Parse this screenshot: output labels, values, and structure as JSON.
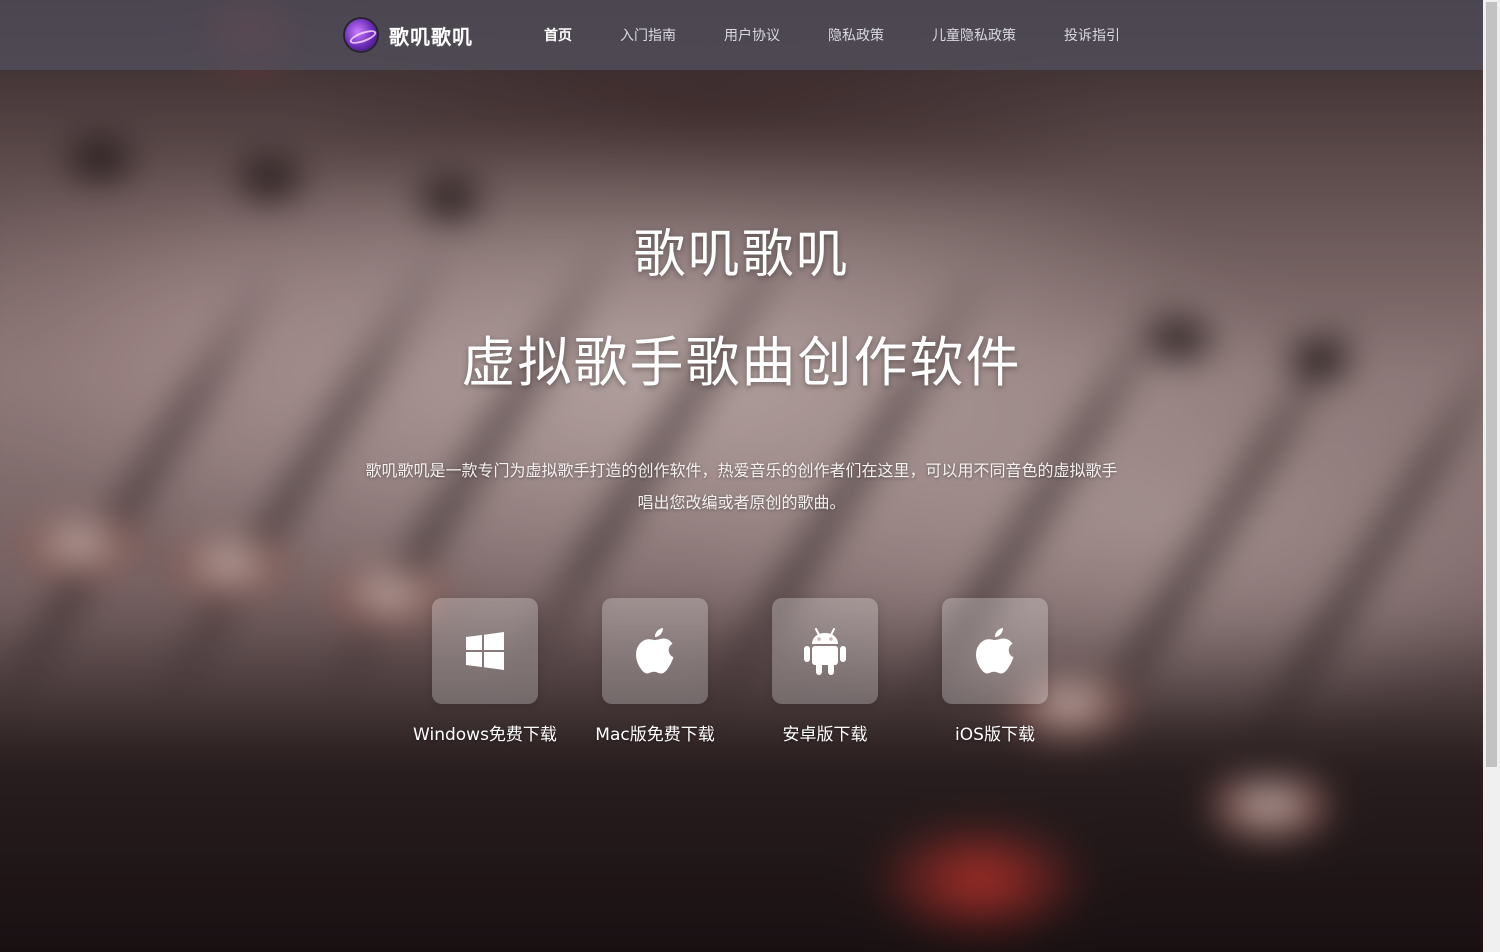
{
  "header": {
    "logo_text": "歌叽歌叽",
    "nav": [
      {
        "label": "首页",
        "active": true
      },
      {
        "label": "入门指南",
        "active": false
      },
      {
        "label": "用户协议",
        "active": false
      },
      {
        "label": "隐私政策",
        "active": false
      },
      {
        "label": "儿童隐私政策",
        "active": false
      },
      {
        "label": "投诉指引",
        "active": false
      }
    ]
  },
  "hero": {
    "title": "歌叽歌叽",
    "subtitle": "虚拟歌手歌曲创作软件",
    "description": "歌叽歌叽是一款专门为虚拟歌手打造的创作软件，热爱音乐的创作者们在这里，可以用不同音色的虚拟歌手唱出您改编或者原创的歌曲。"
  },
  "downloads": [
    {
      "label": "Windows免费下载",
      "icon": "windows-icon"
    },
    {
      "label": "Mac版免费下载",
      "icon": "apple-icon"
    },
    {
      "label": "安卓版下载",
      "icon": "android-icon"
    },
    {
      "label": "iOS版下载",
      "icon": "apple-icon"
    }
  ],
  "colors": {
    "header_bg": "#52505c",
    "text": "#ffffff",
    "nav_text": "#d8d8de"
  }
}
